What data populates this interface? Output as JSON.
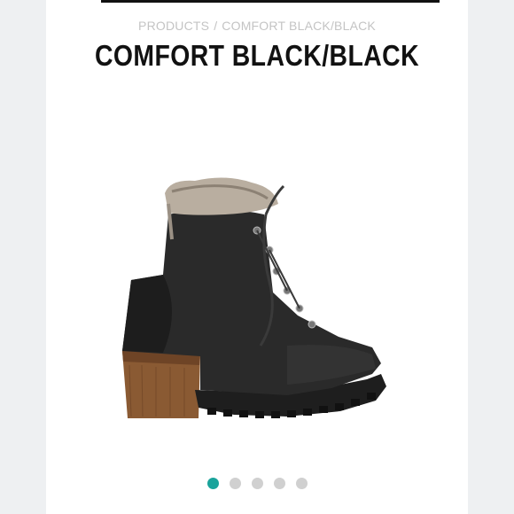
{
  "breadcrumb": {
    "root": "PRODUCTS",
    "separator": "/",
    "current": "COMFORT BLACK/BLACK"
  },
  "product": {
    "title": "COMFORT BLACK/BLACK"
  },
  "carousel": {
    "total": 5,
    "active_index": 0,
    "active_color": "#1aa39b",
    "inactive_color": "#d0d0d0"
  },
  "colors": {
    "title": "#111111",
    "breadcrumb": "#c4c4c4",
    "background": "#ffffff",
    "side_panel": "#eef0f2"
  }
}
